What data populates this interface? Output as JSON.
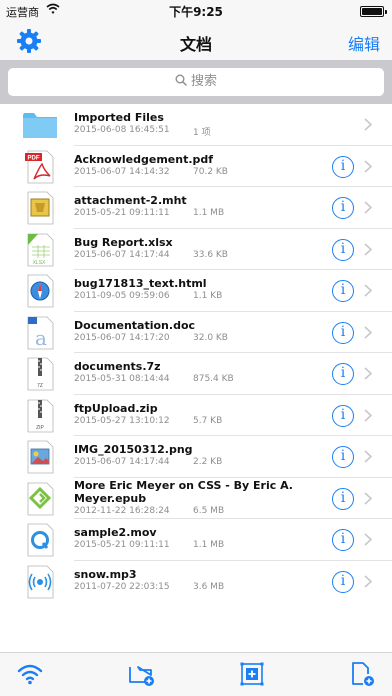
{
  "status_bar": {
    "carrier": "运营商",
    "time": "下午9:25"
  },
  "nav": {
    "title": "文档",
    "edit_label": "编辑"
  },
  "search": {
    "placeholder": "搜索"
  },
  "files": [
    {
      "name": "Imported Files",
      "date": "2015-06-08 16:45:51",
      "size": "1 项",
      "icon": "folder-icon",
      "type": "folder",
      "has_info": false
    },
    {
      "name": "Acknowledgement.pdf",
      "date": "2015-06-07 14:14:32",
      "size": "70.2 KB",
      "icon": "pdf-file-icon",
      "type": "pdf",
      "has_info": true
    },
    {
      "name": "attachment-2.mht",
      "date": "2015-05-21 09:11:11",
      "size": "1.1 MB",
      "icon": "web-archive-file-icon",
      "type": "mht",
      "has_info": true
    },
    {
      "name": "Bug Report.xlsx",
      "date": "2015-06-07 14:17:44",
      "size": "33.6 KB",
      "icon": "excel-file-icon",
      "type": "xlsx",
      "has_info": true
    },
    {
      "name": "bug171813_text.html",
      "date": "2011-09-05 09:59:06",
      "size": "1.1 KB",
      "icon": "html-file-icon",
      "type": "html",
      "has_info": true
    },
    {
      "name": "Documentation.doc",
      "date": "2015-06-07 14:17:20",
      "size": "32.0 KB",
      "icon": "word-file-icon",
      "type": "doc",
      "has_info": true
    },
    {
      "name": "documents.7z",
      "date": "2015-05-31 08:14:44",
      "size": "875.4 KB",
      "icon": "7z-archive-icon",
      "type": "7z",
      "has_info": true
    },
    {
      "name": "ftpUpload.zip",
      "date": "2015-05-27 13:10:12",
      "size": "5.7 KB",
      "icon": "zip-archive-icon",
      "type": "zip",
      "has_info": true
    },
    {
      "name": "IMG_20150312.png",
      "date": "2015-06-07 14:17:44",
      "size": "2.2 KB",
      "icon": "image-file-icon",
      "type": "png",
      "has_info": true
    },
    {
      "name": "More Eric Meyer on CSS - By Eric A. Meyer.epub",
      "name_line1": "More Eric Meyer on CSS - By Eric A.",
      "name_line2": "Meyer.epub",
      "date": "2012-11-22 16:28:24",
      "size": "6.5 MB",
      "icon": "epub-file-icon",
      "type": "epub",
      "has_info": true
    },
    {
      "name": "sample2.mov",
      "date": "2015-05-21 09:11:11",
      "size": "1.1 MB",
      "icon": "video-file-icon",
      "type": "mov",
      "has_info": true
    },
    {
      "name": "snow.mp3",
      "date": "2011-07-20 22:03:15",
      "size": "3.6 MB",
      "icon": "audio-file-icon",
      "type": "mp3",
      "has_info": true
    }
  ],
  "toolbar": [
    {
      "icon": "wifi-icon",
      "action": "wifi-transfer"
    },
    {
      "icon": "new-folder-icon",
      "action": "new-folder"
    },
    {
      "icon": "select-icon",
      "action": "select"
    },
    {
      "icon": "new-file-icon",
      "action": "new-file"
    }
  ],
  "colors": {
    "accent": "#1a7ef5",
    "folder": "#5bbcf0",
    "pdf": "#d8262a",
    "excel": "#6cbd45",
    "epub": "#7cc242"
  }
}
